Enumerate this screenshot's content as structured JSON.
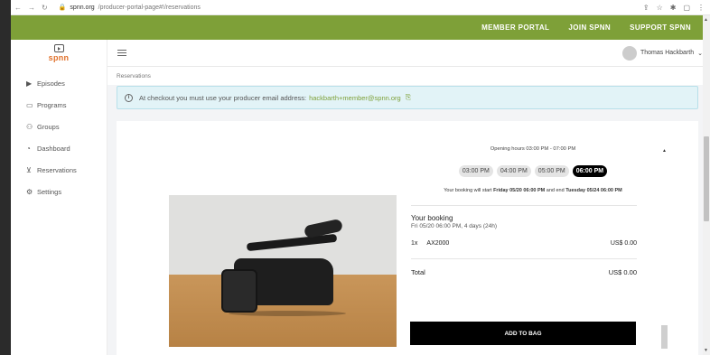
{
  "browser": {
    "url_host": "spnn.org",
    "url_path": "/producer-portal-page#!/reservations"
  },
  "topnav": {
    "member_portal": "MEMBER PORTAL",
    "join": "JOIN SPNN",
    "support": "SUPPORT SPNN"
  },
  "logo": {
    "text": "spnn"
  },
  "sidebar": {
    "items": [
      {
        "label": "Episodes",
        "icon": "play-icon"
      },
      {
        "label": "Programs",
        "icon": "video-icon"
      },
      {
        "label": "Groups",
        "icon": "users-icon"
      },
      {
        "label": "Dashboard",
        "icon": "dashboard-icon"
      },
      {
        "label": "Reservations",
        "icon": "cart-icon"
      },
      {
        "label": "Settings",
        "icon": "gear-icon"
      }
    ]
  },
  "user": {
    "name": "Thomas Hackbarth"
  },
  "breadcrumb": "Reservations",
  "alert": {
    "text": "At checkout you must use your producer email address:",
    "email": "hackbarth+member@spnn.org"
  },
  "booking": {
    "hours": "Opening hours 03:00 PM - 07:00 PM",
    "slots": [
      "03:00 PM",
      "04:00 PM",
      "05:00 PM",
      "06:00 PM"
    ],
    "selected_slot": "06:00 PM",
    "start_prefix": "Your booking will start",
    "start": "Friday 05/20 06:00 PM",
    "mid": "and end",
    "end": "Tuesday 05/24 06:00 PM",
    "your_booking": "Your booking",
    "summary": "Fri 05/20 06:00 PM, 4 days (24h)",
    "item_qty": "1x",
    "item_name": "AX2000",
    "item_price": "US$ 0.00",
    "total_label": "Total",
    "total_value": "US$ 0.00",
    "add_button": "ADD TO BAG"
  },
  "colors": {
    "brand_green": "#7ea038",
    "logo_orange": "#e0702a",
    "alert_bg": "#e2f3f7"
  }
}
